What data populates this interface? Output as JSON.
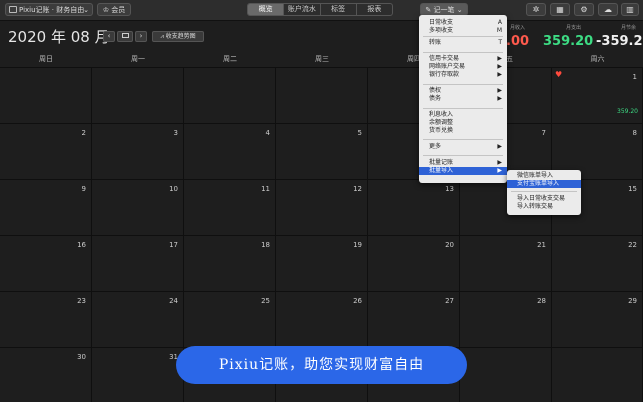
{
  "toolbar": {
    "book_label": "Pixiu记账 · 财务自由",
    "member_label": "会员",
    "tabs": [
      "概览",
      "账户流水",
      "标签",
      "报表"
    ],
    "active_tab": "概览",
    "add_label": "记一笔"
  },
  "header": {
    "month": "2020 年 08 月",
    "prev": "‹",
    "next": "›",
    "trend_label": "收支趋势图",
    "income_label": "月收入",
    "income_value": ".00",
    "expense_label": "月支出",
    "expense_value": "359.20",
    "balance_label": "月节余",
    "balance_value": "-359.20"
  },
  "weekdays": [
    "周日",
    "周一",
    "周二",
    "周三",
    "周四",
    "周五",
    "周六"
  ],
  "days": [
    [
      "",
      "",
      "",
      "",
      "",
      "",
      "1"
    ],
    [
      "2",
      "3",
      "4",
      "5",
      "6",
      "7",
      "8"
    ],
    [
      "9",
      "10",
      "11",
      "12",
      "13",
      "14",
      "15"
    ],
    [
      "16",
      "17",
      "18",
      "19",
      "20",
      "21",
      "22"
    ],
    [
      "23",
      "24",
      "25",
      "26",
      "27",
      "28",
      "29"
    ],
    [
      "30",
      "31",
      "",
      "",
      "",
      "",
      ""
    ]
  ],
  "day1_amount": "359.20",
  "menu": {
    "items": [
      {
        "label": "日常收支",
        "key": "A"
      },
      {
        "label": "多项收支",
        "key": "M"
      },
      {
        "label": "转账",
        "key": "T"
      },
      {
        "label": "信用卡交易",
        "key": "▶"
      },
      {
        "label": "网络账户交易",
        "key": "▶"
      },
      {
        "label": "银行存取款",
        "key": "▶"
      },
      {
        "label": "债权",
        "key": "▶"
      },
      {
        "label": "债务",
        "key": "▶"
      },
      {
        "label": "利息收入",
        "key": ""
      },
      {
        "label": "余额调整",
        "key": ""
      },
      {
        "label": "货币兑换",
        "key": ""
      },
      {
        "label": "更多",
        "key": "▶"
      },
      {
        "label": "批量记账",
        "key": "▶"
      },
      {
        "label": "批量导入",
        "key": "▶"
      }
    ]
  },
  "submenu": {
    "items": [
      "微信账单导入",
      "支付宝账单导入",
      "导入日常收支交易",
      "导入转账交易"
    ]
  },
  "banner": "Pixiu记账，助您实现财富自由",
  "colors": {
    "income": "#ff5a4d",
    "expense": "#3ddc84",
    "accent": "#2e62d6"
  }
}
